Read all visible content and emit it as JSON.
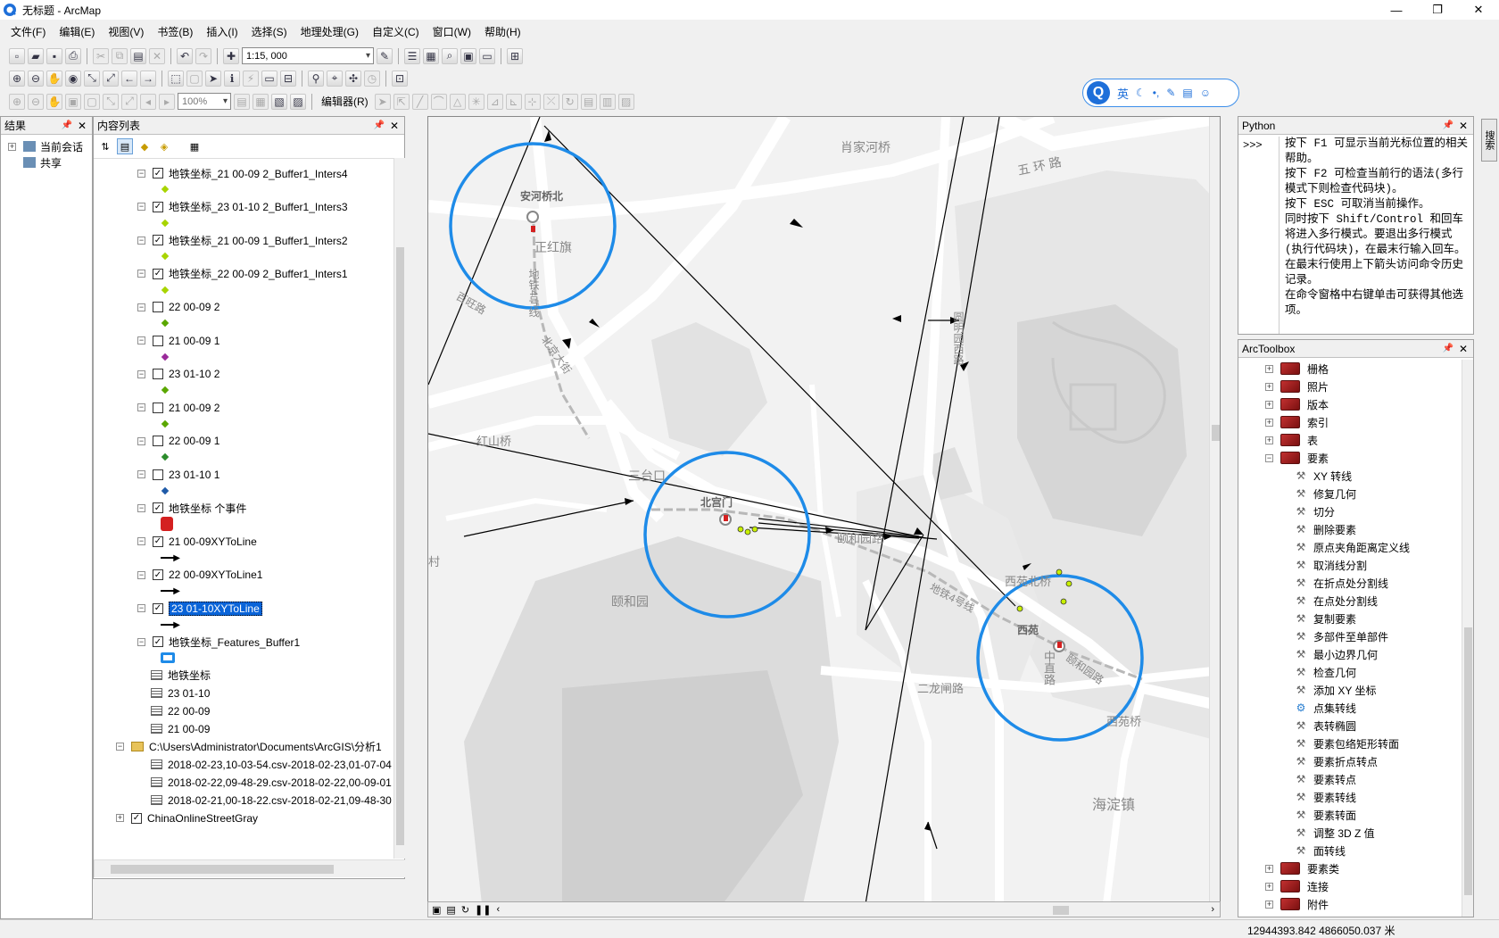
{
  "window": {
    "title": "无标题 - ArcMap",
    "controls": [
      "—",
      "❐",
      "✕"
    ]
  },
  "menu": [
    "文件(F)",
    "编辑(E)",
    "视图(V)",
    "书签(B)",
    "插入(I)",
    "选择(S)",
    "地理处理(G)",
    "自定义(C)",
    "窗口(W)",
    "帮助(H)"
  ],
  "toolbar": {
    "scale_value": "1:15, 000",
    "zoom_value": "100%",
    "editor_label": "编辑器(R)"
  },
  "ime": {
    "lang": "英",
    "logo": "Q"
  },
  "results_panel": {
    "title": "结果",
    "items": [
      "当前会话",
      "共享"
    ]
  },
  "toc_panel": {
    "title": "内容列表",
    "layers": [
      {
        "label": "地铁坐标_21 00-09 2_Buffer1_Inters4",
        "checked": true,
        "sym_color": "#a8d400"
      },
      {
        "label": "地铁坐标_23 01-10 2_Buffer1_Inters3",
        "checked": true,
        "sym_color": "#a8d400"
      },
      {
        "label": "地铁坐标_21 00-09 1_Buffer1_Inters2",
        "checked": true,
        "sym_color": "#a8d400"
      },
      {
        "label": "地铁坐标_22 00-09 2_Buffer1_Inters1",
        "checked": true,
        "sym_color": "#a8d400"
      },
      {
        "label": "22 00-09 2",
        "checked": false,
        "sym_color": "#5aa700"
      },
      {
        "label": "21 00-09 1",
        "checked": false,
        "sym_color": "#9a2a9a"
      },
      {
        "label": "23 01-10 2",
        "checked": false,
        "sym_color": "#5aa700"
      },
      {
        "label": "21 00-09 2",
        "checked": false,
        "sym_color": "#5aa700"
      },
      {
        "label": "22 00-09 1",
        "checked": false,
        "sym_color": "#2c8c2c"
      },
      {
        "label": "23 01-10 1",
        "checked": false,
        "sym_color": "#1e5aa8"
      },
      {
        "label": "地铁坐标 个事件",
        "checked": true,
        "sym_color": "#d42020"
      },
      {
        "label": "21 00-09XYToLine",
        "checked": true,
        "sym_color": "#000000"
      },
      {
        "label": "22 00-09XYToLine1",
        "checked": true,
        "sym_color": "#000000"
      },
      {
        "label": "23 01-10XYToLine",
        "checked": true,
        "sym_color": "#000000"
      },
      {
        "label": "地铁坐标_Features_Buffer1",
        "checked": true,
        "sym_color": "#1e8be8"
      }
    ],
    "tables": [
      "地铁坐标",
      "23 01-10",
      "22 00-09",
      "21 00-09"
    ],
    "folder": "C:\\Users\\Administrator\\Documents\\ArcGIS\\分析1",
    "csv_files": [
      "2018-02-23,10-03-54.csv-2018-02-23,01-07-04",
      "2018-02-22,09-48-29.csv-2018-02-22,00-09-01",
      "2018-02-21,00-18-22.csv-2018-02-21,09-48-30"
    ],
    "basemap": "ChinaOnlineStreetGray"
  },
  "map": {
    "labels": {
      "anheqiaobei": "安河桥北",
      "zhenghongqi": "正红旗",
      "xiaojiahe": "肖家河桥",
      "wuhuanlu": "五 环 路",
      "hongshanqiao": "红山桥",
      "sanyingkou": "三台口",
      "beigongmen": "北宫门",
      "yiheyuanlu": "颐和园路",
      "yiheyuan": "颐和园",
      "xiyuanbeiqiao": "西苑北桥",
      "xiyuan": "西苑",
      "erlongzha": "二龙闸路",
      "xiyuanqiao": "西苑桥",
      "haidianzhen": "海淀镇",
      "line4a": "地铁4号线",
      "line4b": "地铁4号线",
      "yiheyuanlu2": "颐和园路",
      "yuanmingyuanxilu": "圆明园西路",
      "zhongzhilu": "中直路",
      "xiaohe": "北京大街",
      "minghaulu": "百旺路",
      "cun": "村"
    },
    "buffer_color": "#1e8be8"
  },
  "python_panel": {
    "title": "Python",
    "prompt": ">>>",
    "help_lines": [
      "按下 F1 可显示当前光标位置的相关帮助。",
      "按下 F2 可检查当前行的语法(多行模式下则检查代码块)。",
      "按下 ESC 可取消当前操作。",
      "同时按下 Shift/Control 和回车将进入多行模式。要退出多行模式(执行代码块)，在最末行输入回车。",
      "在最末行使用上下箭头访问命令历史记录。",
      "在命令窗格中右键单击可获得其他选项。"
    ]
  },
  "arctoolbox": {
    "title": "ArcToolbox",
    "toolsets_top": [
      "栅格",
      "照片",
      "版本",
      "索引",
      "表",
      "要素"
    ],
    "tools": [
      "XY 转线",
      "修复几何",
      "切分",
      "删除要素",
      "原点夹角距离定义线",
      "取消线分割",
      "在折点处分割线",
      "在点处分割线",
      "复制要素",
      "多部件至单部件",
      "最小边界几何",
      "检查几何",
      "添加 XY 坐标",
      "点集转线",
      "表转椭圆",
      "要素包络矩形转面",
      "要素折点转点",
      "要素转点",
      "要素转线",
      "要素转面",
      "调整 3D Z 值",
      "面转线"
    ],
    "toolsets_bottom": [
      "要素类",
      "连接",
      "附件"
    ]
  },
  "side_tab": "搜索",
  "status": {
    "coords": "12944393.842  4866050.037 米"
  }
}
